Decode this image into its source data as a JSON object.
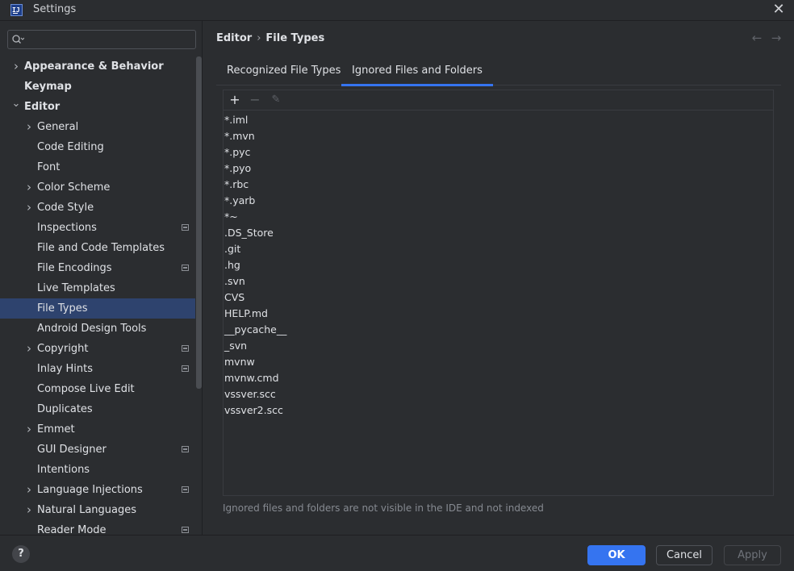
{
  "window": {
    "title": "Settings",
    "logo_text": "IJ"
  },
  "search": {
    "placeholder": "",
    "value": ""
  },
  "sidebar": {
    "items": [
      {
        "label": "Appearance & Behavior",
        "level": 0,
        "chevron": "right",
        "bold": true,
        "badge": false,
        "selected": false
      },
      {
        "label": "Keymap",
        "level": 0,
        "chevron": "none",
        "bold": true,
        "badge": false,
        "selected": false
      },
      {
        "label": "Editor",
        "level": 0,
        "chevron": "down",
        "bold": true,
        "badge": false,
        "selected": false
      },
      {
        "label": "General",
        "level": 1,
        "chevron": "right",
        "bold": false,
        "badge": false,
        "selected": false
      },
      {
        "label": "Code Editing",
        "level": 1,
        "chevron": "none",
        "bold": false,
        "badge": false,
        "selected": false
      },
      {
        "label": "Font",
        "level": 1,
        "chevron": "none",
        "bold": false,
        "badge": false,
        "selected": false
      },
      {
        "label": "Color Scheme",
        "level": 1,
        "chevron": "right",
        "bold": false,
        "badge": false,
        "selected": false
      },
      {
        "label": "Code Style",
        "level": 1,
        "chevron": "right",
        "bold": false,
        "badge": false,
        "selected": false
      },
      {
        "label": "Inspections",
        "level": 1,
        "chevron": "none",
        "bold": false,
        "badge": true,
        "selected": false
      },
      {
        "label": "File and Code Templates",
        "level": 1,
        "chevron": "none",
        "bold": false,
        "badge": false,
        "selected": false
      },
      {
        "label": "File Encodings",
        "level": 1,
        "chevron": "none",
        "bold": false,
        "badge": true,
        "selected": false
      },
      {
        "label": "Live Templates",
        "level": 1,
        "chevron": "none",
        "bold": false,
        "badge": false,
        "selected": false
      },
      {
        "label": "File Types",
        "level": 1,
        "chevron": "none",
        "bold": false,
        "badge": false,
        "selected": true
      },
      {
        "label": "Android Design Tools",
        "level": 1,
        "chevron": "none",
        "bold": false,
        "badge": false,
        "selected": false
      },
      {
        "label": "Copyright",
        "level": 1,
        "chevron": "right",
        "bold": false,
        "badge": true,
        "selected": false
      },
      {
        "label": "Inlay Hints",
        "level": 1,
        "chevron": "none",
        "bold": false,
        "badge": true,
        "selected": false
      },
      {
        "label": "Compose Live Edit",
        "level": 1,
        "chevron": "none",
        "bold": false,
        "badge": false,
        "selected": false
      },
      {
        "label": "Duplicates",
        "level": 1,
        "chevron": "none",
        "bold": false,
        "badge": false,
        "selected": false
      },
      {
        "label": "Emmet",
        "level": 1,
        "chevron": "right",
        "bold": false,
        "badge": false,
        "selected": false
      },
      {
        "label": "GUI Designer",
        "level": 1,
        "chevron": "none",
        "bold": false,
        "badge": true,
        "selected": false
      },
      {
        "label": "Intentions",
        "level": 1,
        "chevron": "none",
        "bold": false,
        "badge": false,
        "selected": false
      },
      {
        "label": "Language Injections",
        "level": 1,
        "chevron": "right",
        "bold": false,
        "badge": true,
        "selected": false
      },
      {
        "label": "Natural Languages",
        "level": 1,
        "chevron": "right",
        "bold": false,
        "badge": false,
        "selected": false
      },
      {
        "label": "Reader Mode",
        "level": 1,
        "chevron": "none",
        "bold": false,
        "badge": true,
        "selected": false
      }
    ]
  },
  "breadcrumb": {
    "parent": "Editor",
    "separator": "›",
    "current": "File Types"
  },
  "nav": {
    "back": "←",
    "forward": "→"
  },
  "tabs": [
    {
      "label": "Recognized File Types",
      "active": false
    },
    {
      "label": "Ignored Files and Folders",
      "active": true
    }
  ],
  "toolbar": {
    "add": "+",
    "remove": "−",
    "edit": "✎"
  },
  "ignored_patterns": [
    "*.iml",
    "*.mvn",
    "*.pyc",
    "*.pyo",
    "*.rbc",
    "*.yarb",
    "*~",
    ".DS_Store",
    ".git",
    ".hg",
    ".svn",
    "CVS",
    "HELP.md",
    "__pycache__",
    "_svn",
    "mvnw",
    "mvnw.cmd",
    "vssver.scc",
    "vssver2.scc"
  ],
  "hint": "Ignored files and folders are not visible in the IDE and not indexed",
  "footer": {
    "help": "?",
    "ok": "OK",
    "cancel": "Cancel",
    "apply": "Apply"
  },
  "colors": {
    "accent": "#3574f0",
    "selection": "#2e436e",
    "background": "#2b2d30"
  }
}
